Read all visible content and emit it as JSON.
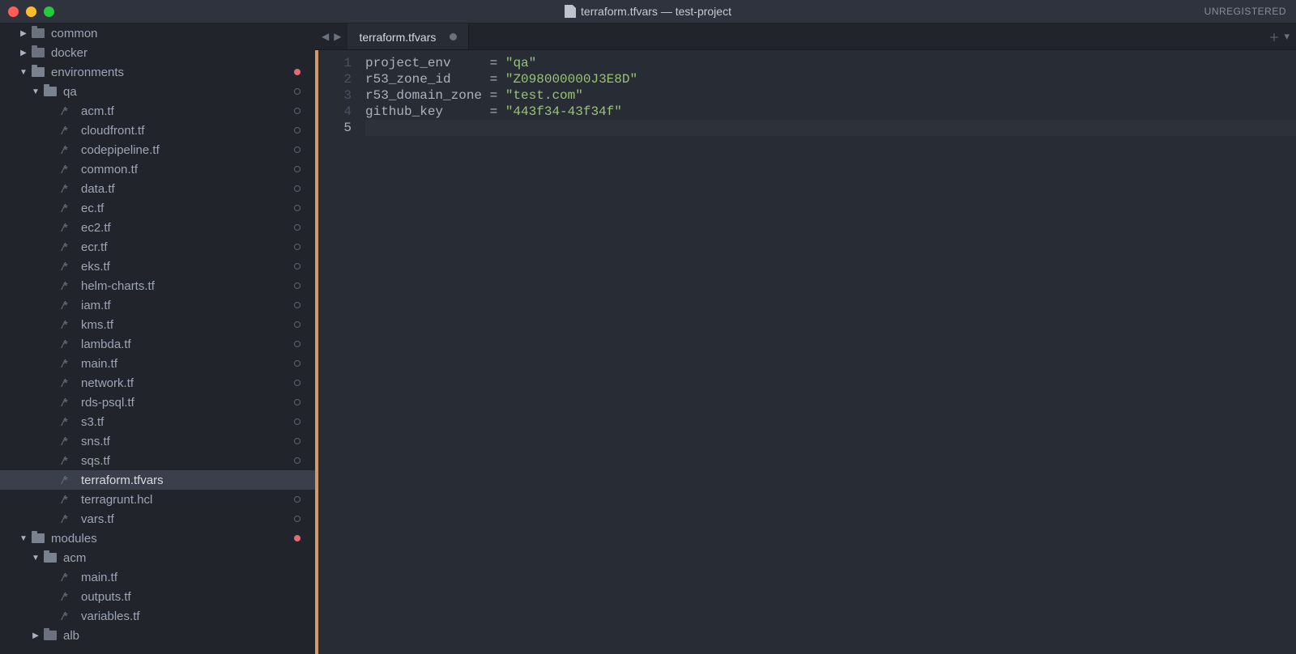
{
  "window": {
    "title": "terraform.tfvars — test-project",
    "unregistered_label": "UNREGISTERED"
  },
  "tab": {
    "label": "terraform.tfvars"
  },
  "sidebar": {
    "items": [
      {
        "label": "common",
        "kind": "folder",
        "state": "closed",
        "pad": 25,
        "status": null
      },
      {
        "label": "docker",
        "kind": "folder",
        "state": "closed",
        "pad": 25,
        "status": null
      },
      {
        "label": "environments",
        "kind": "folder",
        "state": "open",
        "pad": 25,
        "status": "red"
      },
      {
        "label": "qa",
        "kind": "folder",
        "state": "open",
        "pad": 40,
        "status": "gray"
      },
      {
        "label": "acm.tf",
        "kind": "file",
        "pad": 70,
        "status": "gray"
      },
      {
        "label": "cloudfront.tf",
        "kind": "file",
        "pad": 70,
        "status": "gray"
      },
      {
        "label": "codepipeline.tf",
        "kind": "file",
        "pad": 70,
        "status": "gray"
      },
      {
        "label": "common.tf",
        "kind": "file",
        "pad": 70,
        "status": "gray"
      },
      {
        "label": "data.tf",
        "kind": "file",
        "pad": 70,
        "status": "gray"
      },
      {
        "label": "ec.tf",
        "kind": "file",
        "pad": 70,
        "status": "gray"
      },
      {
        "label": "ec2.tf",
        "kind": "file",
        "pad": 70,
        "status": "gray"
      },
      {
        "label": "ecr.tf",
        "kind": "file",
        "pad": 70,
        "status": "gray"
      },
      {
        "label": "eks.tf",
        "kind": "file",
        "pad": 70,
        "status": "gray"
      },
      {
        "label": "helm-charts.tf",
        "kind": "file",
        "pad": 70,
        "status": "gray"
      },
      {
        "label": "iam.tf",
        "kind": "file",
        "pad": 70,
        "status": "gray"
      },
      {
        "label": "kms.tf",
        "kind": "file",
        "pad": 70,
        "status": "gray"
      },
      {
        "label": "lambda.tf",
        "kind": "file",
        "pad": 70,
        "status": "gray"
      },
      {
        "label": "main.tf",
        "kind": "file",
        "pad": 70,
        "status": "gray"
      },
      {
        "label": "network.tf",
        "kind": "file",
        "pad": 70,
        "status": "gray"
      },
      {
        "label": "rds-psql.tf",
        "kind": "file",
        "pad": 70,
        "status": "gray"
      },
      {
        "label": "s3.tf",
        "kind": "file",
        "pad": 70,
        "status": "gray"
      },
      {
        "label": "sns.tf",
        "kind": "file",
        "pad": 70,
        "status": "gray"
      },
      {
        "label": "sqs.tf",
        "kind": "file",
        "pad": 70,
        "status": "gray"
      },
      {
        "label": "terraform.tfvars",
        "kind": "file",
        "pad": 70,
        "status": null,
        "selected": true
      },
      {
        "label": "terragrunt.hcl",
        "kind": "file",
        "pad": 70,
        "status": "gray"
      },
      {
        "label": "vars.tf",
        "kind": "file",
        "pad": 70,
        "status": "gray"
      },
      {
        "label": "modules",
        "kind": "folder",
        "state": "open",
        "pad": 25,
        "status": "red"
      },
      {
        "label": "acm",
        "kind": "folder",
        "state": "open",
        "pad": 40,
        "status": null
      },
      {
        "label": "main.tf",
        "kind": "file",
        "pad": 70,
        "status": null
      },
      {
        "label": "outputs.tf",
        "kind": "file",
        "pad": 70,
        "status": null
      },
      {
        "label": "variables.tf",
        "kind": "file",
        "pad": 70,
        "status": null
      },
      {
        "label": "alb",
        "kind": "folder",
        "state": "closed",
        "pad": 40,
        "status": null
      }
    ]
  },
  "code": {
    "active_line": 5,
    "lines": [
      {
        "n": 1,
        "name": "project_env",
        "pad": 5,
        "value": "\"qa\""
      },
      {
        "n": 2,
        "name": "r53_zone_id",
        "pad": 5,
        "value": "\"Z098000000J3E8D\""
      },
      {
        "n": 3,
        "name": "r53_domain_zone",
        "pad": 1,
        "value": "\"test.com\""
      },
      {
        "n": 4,
        "name": "github_key",
        "pad": 6,
        "value": "\"443f34-43f34f\""
      },
      {
        "n": 5,
        "empty": true
      }
    ]
  }
}
